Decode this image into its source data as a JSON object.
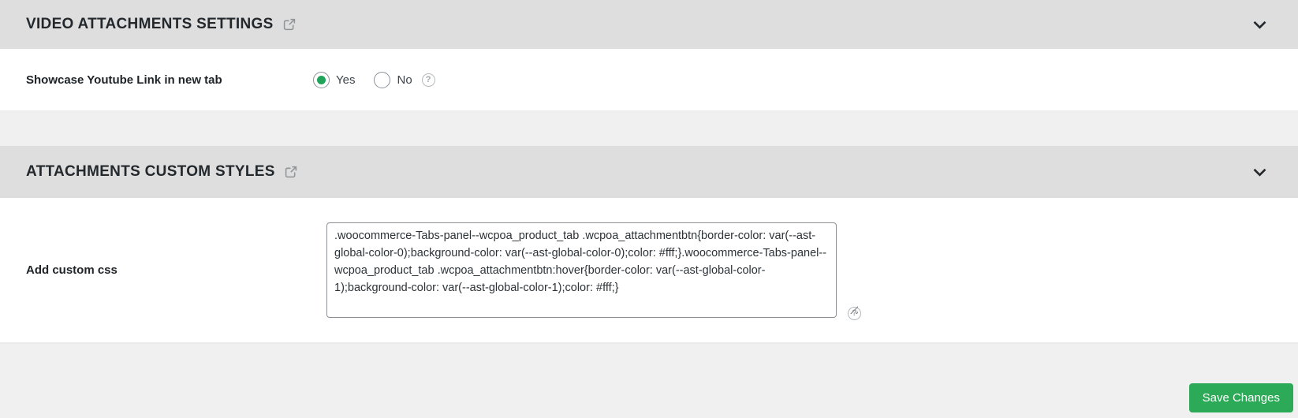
{
  "colors": {
    "header_bg": "#dedede",
    "page_bg": "#f0f0f1",
    "panel_bg": "#ffffff",
    "accent_green": "#2daa57",
    "radio_selected_green": "#21a45a",
    "icon_gray": "#8f9499"
  },
  "sections": {
    "video": {
      "title": "VIDEO ATTACHMENTS SETTINGS"
    },
    "styles": {
      "title": "ATTACHMENTS CUSTOM STYLES"
    }
  },
  "video_settings": {
    "label": "Showcase Youtube Link in new tab",
    "options": [
      {
        "label": "Yes",
        "selected": true
      },
      {
        "label": "No",
        "selected": false
      }
    ],
    "selected_value": "Yes"
  },
  "custom_css": {
    "label": "Add custom css",
    "value": ".woocommerce-Tabs-panel--wcpoa_product_tab .wcpoa_attachmentbtn{border-color: var(--ast-global-color-0);background-color: var(--ast-global-color-0);color: #fff;}.woocommerce-Tabs-panel--wcpoa_product_tab .wcpoa_attachmentbtn:hover{border-color: var(--ast-global-color-1);background-color: var(--ast-global-color-1);color: #fff;}"
  },
  "footer": {
    "save_button_label": "Save Changes"
  },
  "icons": {
    "help_glyph": "?",
    "external_link_name": "external-link-icon",
    "chevron_name": "chevron-down-icon",
    "help_name": "help-icon"
  }
}
